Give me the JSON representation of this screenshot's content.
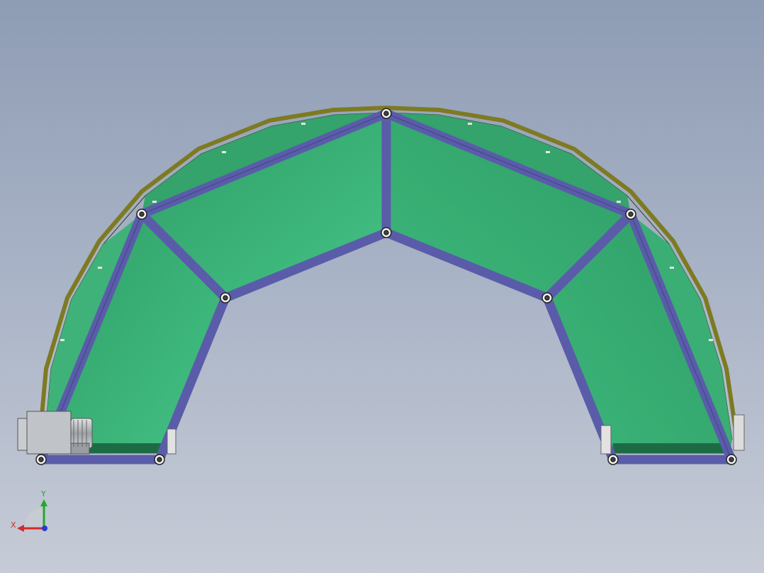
{
  "triad": {
    "x_label": "X",
    "y_label": "Y",
    "x_color": "#d42a2a",
    "y_color": "#1faa2a",
    "z_color": "#2a3ad4"
  },
  "colors": {
    "background_top": "#8e9cb4",
    "belt_green": "#3aaa72",
    "frame_purple": "#5c5ea8",
    "rail_olive": "#8a8a2a",
    "motor_grey": "#b8bcc0"
  }
}
